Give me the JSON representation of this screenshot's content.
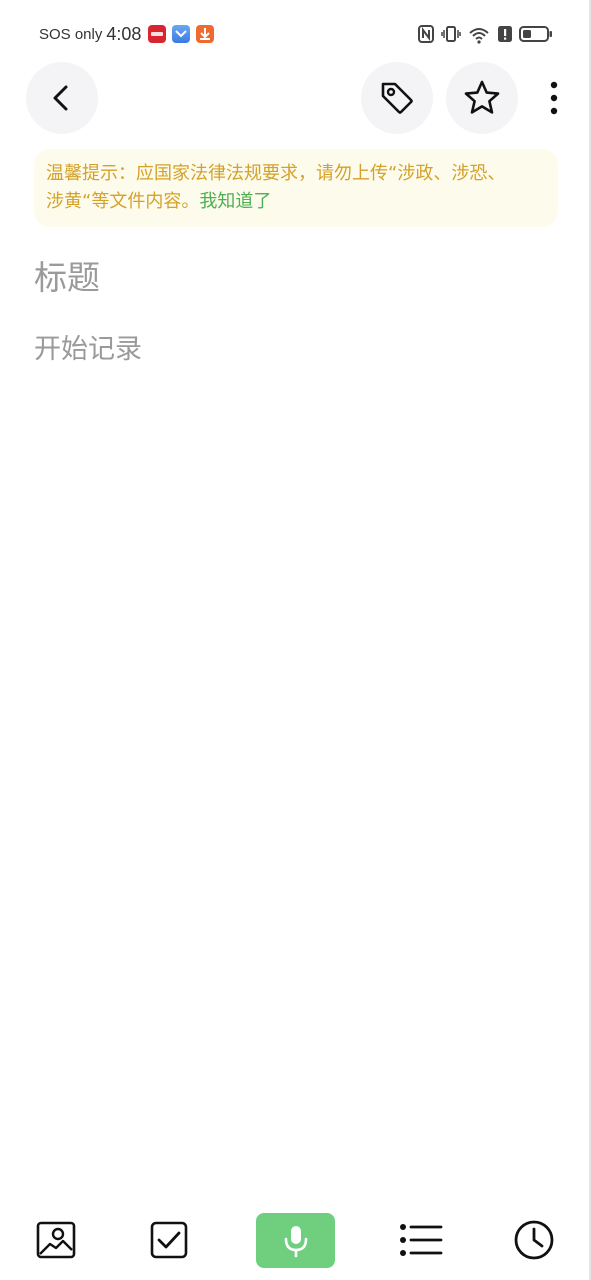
{
  "status_bar": {
    "carrier": "SOS only",
    "time": "4:08"
  },
  "nav": {
    "back": "back-icon",
    "tag": "tag-icon",
    "star": "star-icon",
    "more": "more-vertical-icon"
  },
  "notice": {
    "text": "温馨提示：应国家法律法规要求，请勿上传“涉政、涉恐、涉黄“等文件内容。",
    "ack": "我知道了"
  },
  "editor": {
    "title_placeholder": "标题",
    "body_placeholder": "开始记录"
  },
  "toolbar": {
    "items": [
      "image-icon",
      "checkbox-icon",
      "microphone-icon",
      "list-icon",
      "clock-icon"
    ],
    "accent": "#6fcf7e"
  },
  "colors": {
    "notice_text": "#d4a12a",
    "notice_bg": "#fdfbeb",
    "ack": "#4caf50",
    "placeholder": "#9a9a9a"
  }
}
